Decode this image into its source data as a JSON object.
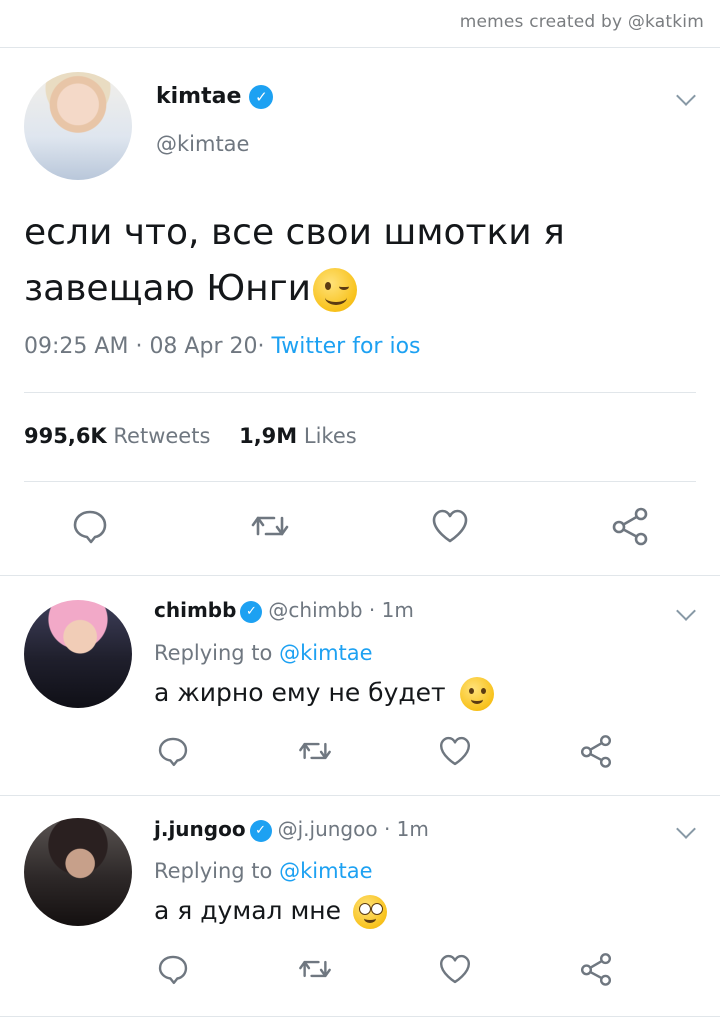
{
  "credit": "memes created by @katkim",
  "main_tweet": {
    "name": "kimtae",
    "handle": "@kimtae",
    "text_line1": "если что, все свои шмотки я",
    "text_line2": "завещаю Юнги",
    "time": "09:25 AM",
    "date": "08 Apr 20",
    "client": "Twitter for ios",
    "retweets_count": "995,6K",
    "retweets_label": "Retweets",
    "likes_count": "1,9M",
    "likes_label": "Likes"
  },
  "replies": [
    {
      "name": "chimbb",
      "handle": "@chimbb",
      "age": "1m",
      "replying_label": "Replying to",
      "replying_to": "@kimtae",
      "text": "а жирно ему не будет"
    },
    {
      "name": "j.jungoo",
      "handle": "@j.jungoo",
      "age": "1m",
      "replying_label": "Replying to",
      "replying_to": "@kimtae",
      "text": "а я думал мне"
    }
  ],
  "icons": {
    "verified": "verified-badge-icon",
    "reply": "reply-icon",
    "retweet": "retweet-icon",
    "like": "heart-icon",
    "share": "share-icon",
    "menu": "chevron-down-icon"
  },
  "colors": {
    "accent": "#1da1f2",
    "muted": "#6f7780",
    "divider": "#e1e6ea"
  }
}
